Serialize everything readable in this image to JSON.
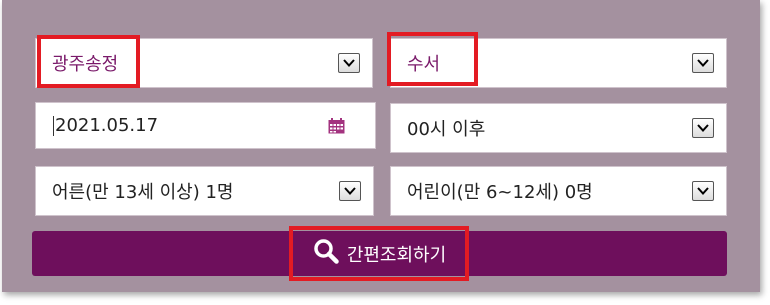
{
  "form": {
    "departure_station": "광주송정",
    "arrival_station": "수서",
    "date": "2021.05.17",
    "time": "00시 이후",
    "adults": "어른(만 13세 이상) 1명",
    "children": "어린이(만 6~12세) 0명",
    "search_label": "간편조회하기"
  },
  "icons": {
    "dropdown": "chevron-down-icon",
    "calendar": "calendar-icon",
    "search": "search-icon"
  },
  "colors": {
    "background": "#a4919f",
    "accent": "#6e0f5c",
    "highlight": "#e31b23",
    "station_text": "#7a1a6a"
  }
}
